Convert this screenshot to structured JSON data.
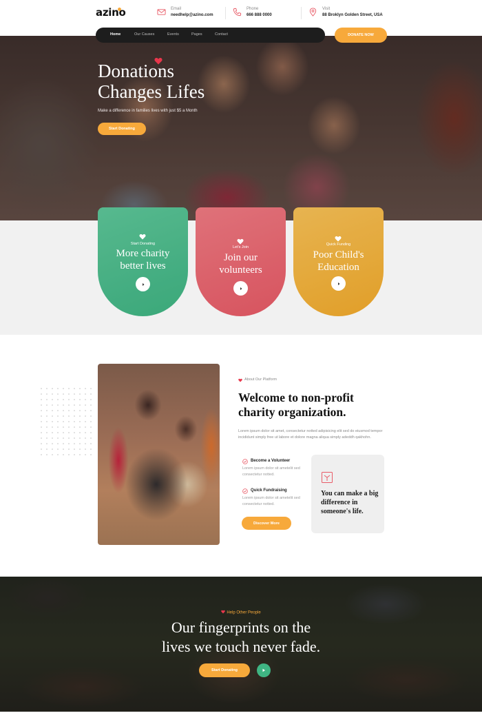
{
  "brand": {
    "logo": "azino",
    "accent": "#f7a93b",
    "green": "#3fb583",
    "red": "#e85a66"
  },
  "contacts": [
    {
      "label": "Email",
      "value": "needhelp@azino.com",
      "icon": "mail-icon"
    },
    {
      "label": "Phone",
      "value": "666 888 0000",
      "icon": "phone-icon"
    },
    {
      "label": "Visit",
      "value": "88 Broklyn Golden Street, USA",
      "icon": "location-pin-icon"
    }
  ],
  "nav": {
    "items": [
      "Home",
      "Our Causes",
      "Events",
      "Pages",
      "Contact"
    ],
    "donate": "DONATE NOW"
  },
  "hero": {
    "title_line1": "Donations",
    "title_line2": "Changes Lifes",
    "subtitle": "Make a difference in families lives with just $5 a Month",
    "button": "Start Donating"
  },
  "cards": [
    {
      "small": "Start Donating",
      "line1": "More charity",
      "line2": "better lives",
      "color": "#3fb583"
    },
    {
      "small": "Let's Join",
      "line1": "Join our",
      "line2": "volunteers",
      "color": "#e85a66"
    },
    {
      "small": "Quick Funding",
      "line1": "Poor Child's",
      "line2": "Education",
      "color": "#f3ab2c"
    }
  ],
  "about": {
    "tag": "About Our Platform",
    "title_line1": "Welcome to non-profit",
    "title_line2": "charity organization.",
    "text": "Lorem ipsum dolor sit amet, consectetur notted adipisicing elit sed do eiusmod tempor incididunt simply free ut labore et dolore magna aliqua simply adeddh qakhohn.",
    "features": [
      {
        "title": "Become a Volunteer",
        "desc": "Lorem ipsum dolor sit ametelit sed consectetur notted."
      },
      {
        "title": "Quick Fundraising",
        "desc": "Lorem ipsum dolor sit ametelit sed consectetur notted."
      }
    ],
    "button": "Discover More",
    "box_text": "You can make a big difference in someone's life."
  },
  "cta": {
    "tag": "Help Other People",
    "title_line1": "Our fingerprints on the",
    "title_line2": "lives we touch never fade.",
    "button": "Start Donating"
  }
}
